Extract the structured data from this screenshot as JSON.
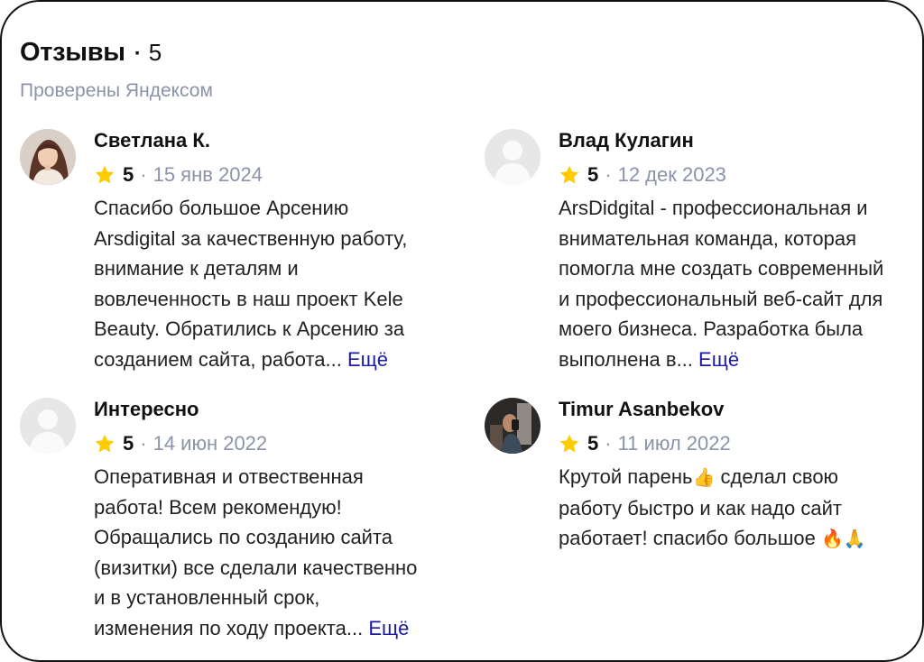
{
  "header": {
    "title": "Отзывы",
    "separator": "·",
    "count": "5",
    "subtitle": "Проверены Яндексом"
  },
  "colors": {
    "star": "#ffcc00",
    "more_link": "#1a1aa6",
    "muted": "#8a93a8"
  },
  "reviews": [
    {
      "name": "Светлана К.",
      "rating": "5",
      "separator": "·",
      "date": "15 янв 2024",
      "avatar": "user-photo",
      "lines": [
        "Спасибо большое Арсению",
        "Arsdigital за качественную работу,",
        "внимание к деталям и",
        "вовлеченность в наш проект Kele",
        "Beauty. Обратились к Арсению за",
        "созданием сайта, работа..."
      ],
      "more": "Ещё"
    },
    {
      "name": "Влад Кулагин",
      "rating": "5",
      "separator": "·",
      "date": "12 дек 2023",
      "avatar": "placeholder-avatar",
      "lines": [
        "ArsDidgital - профессиональная и",
        "внимательная команда, которая",
        "помогла мне создать современный",
        "и профессиональный веб-сайт для",
        "моего бизнеса. Разработка была",
        "выполнена в..."
      ],
      "more": "Ещё"
    },
    {
      "name": "Интересно",
      "rating": "5",
      "separator": "·",
      "date": "14 июн 2022",
      "avatar": "placeholder-avatar",
      "lines": [
        "Оперативная и отвественная",
        "работа! Всем рекомендую!",
        "Обращались по созданию сайта",
        "(визитки) все сделали качественно",
        "и в установленный срок,",
        "изменения по ходу проекта..."
      ],
      "more": "Ещё"
    },
    {
      "name": "Timur Asanbekov",
      "rating": "5",
      "separator": "·",
      "date": "11 июл 2022",
      "avatar": "user-photo",
      "lines": [
        "Крутой парень",
        "работу быстро и как надо сайт",
        "работает! спасибо большое "
      ],
      "line1_emoji": "👍",
      "line1_rest": " сделал свою",
      "line3_emoji": "🔥🙏"
    }
  ]
}
